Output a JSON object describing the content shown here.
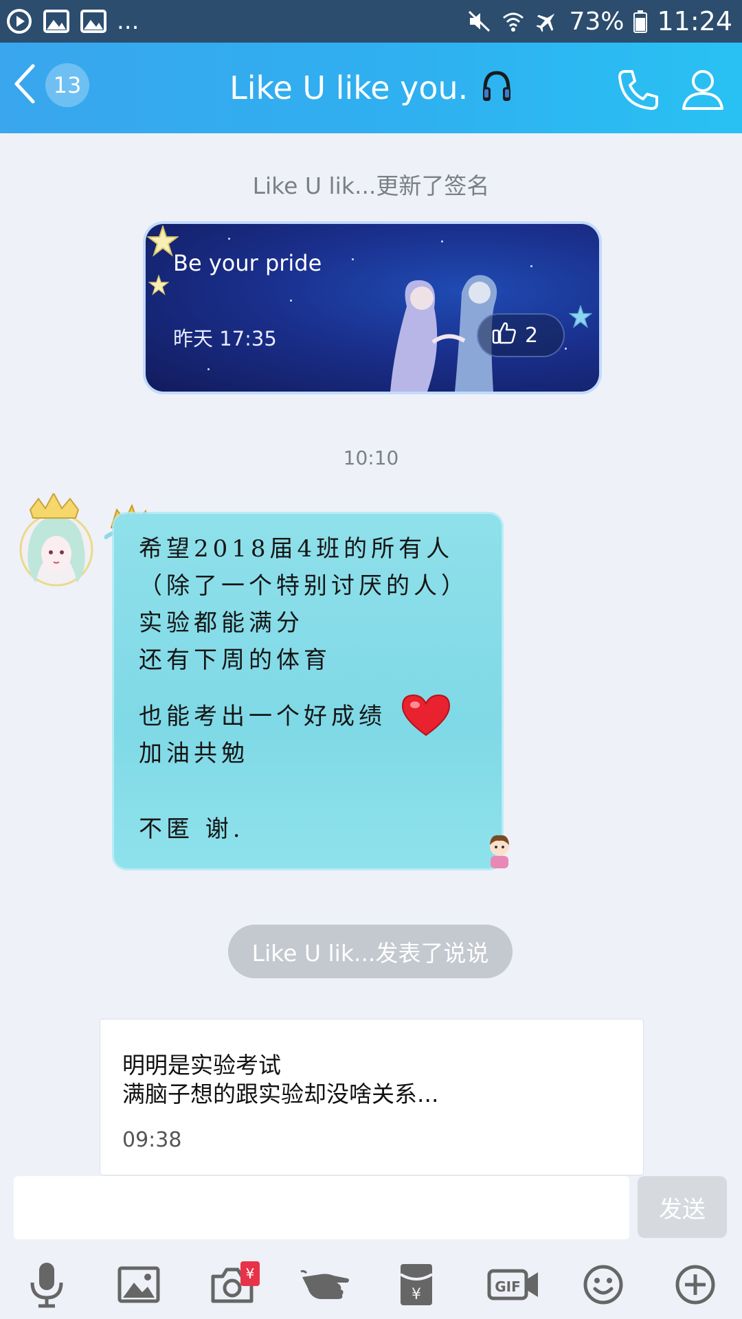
{
  "status_bar": {
    "more": "...",
    "battery_pct": "73%",
    "time": "11:24"
  },
  "header": {
    "unread_badge": "13",
    "title": "Like U like you.",
    "title_icon": "headphones-icon",
    "accent": "#2fb0f0"
  },
  "chat": {
    "signature_notice": "Like U lik...更新了签名",
    "signature_card": {
      "text": "Be your pride",
      "time": "昨天 17:35",
      "likes": "2"
    },
    "timestamp": "10:10",
    "message": {
      "lines": [
        "希望2018届4班的所有人",
        "（除了一个特别讨厌的人）",
        "实验都能满分",
        "还有下周的体育",
        "也能考出一个好成绩",
        "加油共勉",
        "不匿 谢."
      ],
      "bubble_color": "#8fe0ea"
    },
    "post_notice": "Like U lik...发表了说说",
    "post_card": {
      "line1": "明明是实验考试",
      "line2": "满脑子想的跟实验却没啥关系...",
      "time": "09:38"
    }
  },
  "input": {
    "value": "",
    "send_label": "发送"
  },
  "toolbar": {
    "items": [
      "microphone-icon",
      "image-icon",
      "camera-icon",
      "poke-hand-icon",
      "red-envelope-icon",
      "gif-icon",
      "emoji-icon",
      "plus-icon"
    ],
    "redpacket_badge": "¥",
    "gif_label": "GIF"
  }
}
